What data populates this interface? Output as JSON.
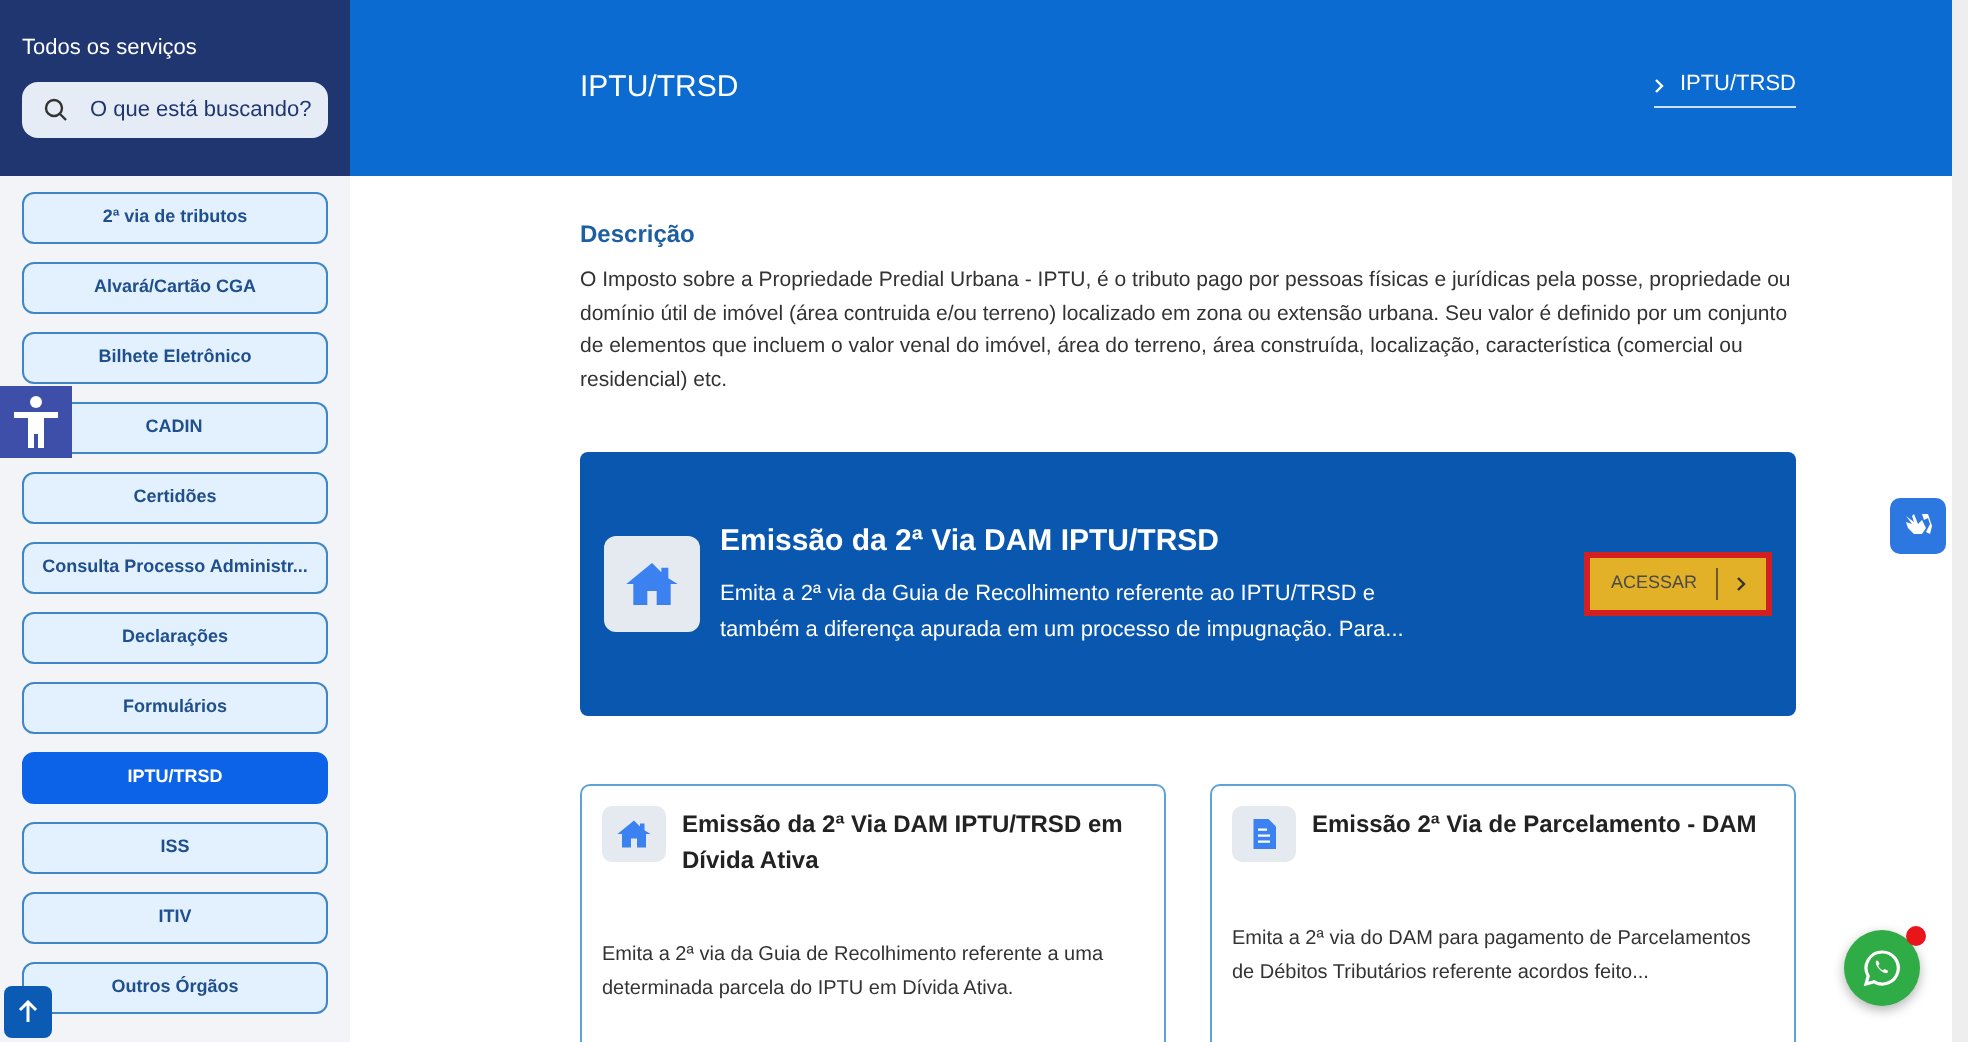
{
  "sidebar": {
    "title": "Todos os serviços",
    "search": {
      "placeholder": "O que está buscando?"
    },
    "items": [
      {
        "label": "2ª via de tributos",
        "selected": false
      },
      {
        "label": "Alvará/Cartão CGA",
        "selected": false
      },
      {
        "label": "Bilhete Eletrônico",
        "selected": false
      },
      {
        "label": "CADIN",
        "selected": false
      },
      {
        "label": "Certidões",
        "selected": false
      },
      {
        "label": "Consulta Processo Administr...",
        "selected": false
      },
      {
        "label": "Declarações",
        "selected": false
      },
      {
        "label": "Formulários",
        "selected": false
      },
      {
        "label": "IPTU/TRSD",
        "selected": true
      },
      {
        "label": "ISS",
        "selected": false
      },
      {
        "label": "ITIV",
        "selected": false
      },
      {
        "label": "Outros Órgãos",
        "selected": false
      }
    ]
  },
  "header": {
    "title": "IPTU/TRSD",
    "breadcrumb": "IPTU/TRSD"
  },
  "description": {
    "heading": "Descrição",
    "text": "O Imposto sobre a Propriedade Predial Urbana - IPTU, é o tributo pago por pessoas físicas e jurídicas pela posse, propriedade ou domínio útil de imóvel (área contruida e/ou terreno) localizado em zona ou extensão urbana. Seu valor é definido por um conjunto de elementos que incluem o valor venal do imóvel, área do terreno, área construída, localização, característica (comercial ou residencial) etc."
  },
  "featured": {
    "title": "Emissão da 2ª Via DAM IPTU/TRSD",
    "text": "Emita a 2ª via da Guia de Recolhimento referente ao IPTU/TRSD e também a diferença apurada em um processo de impugnação. Para...",
    "button": "ACESSAR"
  },
  "services": [
    {
      "title": "Emissão da 2ª Via DAM IPTU/TRSD em Dívida Ativa",
      "text": "Emita a 2ª via da Guia de Recolhimento referente a uma determinada parcela do IPTU em Dívida Ativa."
    },
    {
      "title": "Emissão 2ª Via de Parcelamento - DAM",
      "text": "Emita a 2ª via do DAM para pagamento de Parcelamentos de Débitos Tributários referente acordos feito..."
    }
  ],
  "whatsapp": {
    "notification": true
  }
}
